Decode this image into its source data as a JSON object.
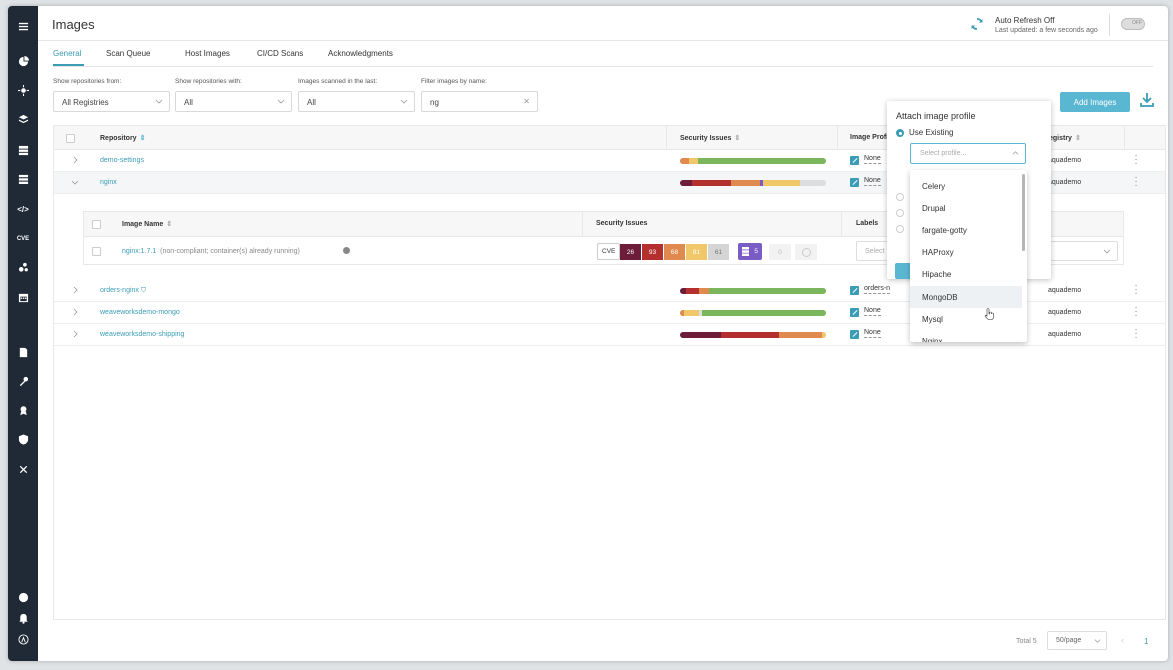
{
  "page": {
    "title": "Images"
  },
  "refresh": {
    "title": "Auto Refresh Off",
    "subtitle": "Last updated: a few seconds ago",
    "toggle_label": "OFF"
  },
  "tabs": [
    {
      "label": "General"
    },
    {
      "label": "Scan Queue"
    },
    {
      "label": "Host Images"
    },
    {
      "label": "CI/CD Scans"
    },
    {
      "label": "Acknowledgments"
    }
  ],
  "filters": {
    "repos_from": {
      "label": "Show repositories from:",
      "value": "All Registries"
    },
    "repos_with": {
      "label": "Show repositories with:",
      "value": "All"
    },
    "scanned": {
      "label": "Images scanned in the last:",
      "value": "All"
    },
    "name": {
      "label": "Filter images by name:",
      "value": "ng"
    }
  },
  "actions": {
    "add_images": "Add Images"
  },
  "table": {
    "headers": {
      "repository": "Repository",
      "security": "Security Issues",
      "profile": "Image Profil",
      "registry": "egistry"
    },
    "rows": [
      {
        "name": "demo-settings",
        "profile": "None",
        "registry": "aquademo",
        "bar": [
          {
            "c": "#e08a4f",
            "w": 6
          },
          {
            "c": "#f0c86a",
            "w": 6
          },
          {
            "c": "#7bb65c",
            "w": 88
          }
        ]
      },
      {
        "name": "nginx",
        "profile": "None",
        "registry": "aquademo",
        "bar": [
          {
            "c": "#6b1d3a",
            "w": 8
          },
          {
            "c": "#b3302e",
            "w": 27
          },
          {
            "c": "#e08a4f",
            "w": 20
          },
          {
            "c": "#7b5bc4",
            "w": 2
          },
          {
            "c": "#f0c86a",
            "w": 25
          },
          {
            "c": "#dddddd",
            "w": 18
          }
        ]
      },
      {
        "name": "orders-nginx",
        "profile": "orders-n",
        "registry": "aquademo",
        "bar": [
          {
            "c": "#6b1d3a",
            "w": 4
          },
          {
            "c": "#b3302e",
            "w": 9
          },
          {
            "c": "#e08a4f",
            "w": 7
          },
          {
            "c": "#7bb65c",
            "w": 80
          }
        ]
      },
      {
        "name": "weaveworksdemo-mongo",
        "profile": "None",
        "registry": "aquademo",
        "bar": [
          {
            "c": "#e08a4f",
            "w": 3
          },
          {
            "c": "#f0c86a",
            "w": 10
          },
          {
            "c": "#dddddd",
            "w": 2
          },
          {
            "c": "#7bb65c",
            "w": 85
          }
        ]
      },
      {
        "name": "weaveworksdemo-shipping",
        "profile": "None",
        "registry": "aquademo",
        "bar": [
          {
            "c": "#6b1d3a",
            "w": 28
          },
          {
            "c": "#b3302e",
            "w": 40
          },
          {
            "c": "#e08a4f",
            "w": 29
          },
          {
            "c": "#f0c86a",
            "w": 3
          }
        ]
      }
    ]
  },
  "subtable": {
    "headers": {
      "image_name": "Image Name",
      "security": "Security Issues",
      "labels": "Labels"
    },
    "image": {
      "name": "nginx:1.7.1",
      "note": "(non-compliant; container(s) already running)"
    },
    "cve_tag": "CVE",
    "severity": [
      {
        "value": "26",
        "color": "#6b1d3a"
      },
      {
        "value": "93",
        "color": "#b3302e"
      },
      {
        "value": "68",
        "color": "#e08a4f"
      },
      {
        "value": "81",
        "color": "#f0c86a"
      },
      {
        "value": "61",
        "color": "#d5d5d5"
      }
    ],
    "badges": {
      "purple": "5",
      "grey1": "0"
    },
    "labels_placeholder": "Select"
  },
  "popup": {
    "title": "Attach image profile",
    "radio_existing": "Use Existing",
    "select_placeholder": "Select profile..."
  },
  "dropdown": {
    "items": [
      "Celery",
      "Drupal",
      "fargate-gotty",
      "HAProxy",
      "Hipache",
      "MongoDB",
      "Mysql",
      "Nginx"
    ],
    "hovered": "MongoDB"
  },
  "footer": {
    "total": "Total 5",
    "page_size": "50/page",
    "page": "1"
  },
  "colors": {
    "accent": "#3b9cb5",
    "button": "#5ab7d2",
    "sidebar": "#1f2a36"
  },
  "sidebar_icons": [
    "menu-icon",
    "dashboard-icon",
    "settings-sun-icon",
    "images-icon",
    "workloads-icon",
    "infrastructure-icon",
    "code-icon",
    "cve-icon",
    "services-icon",
    "calendar-icon",
    "audit-icon",
    "tools-icon",
    "badge-icon",
    "shield-icon",
    "wrench-icon",
    "help-icon",
    "bell-icon",
    "user-icon"
  ]
}
